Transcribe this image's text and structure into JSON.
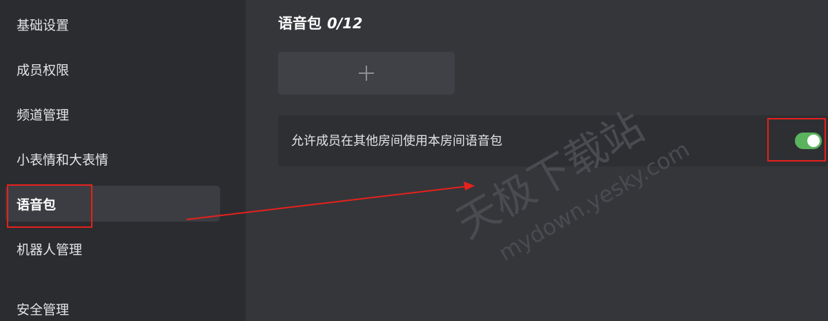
{
  "sidebar": {
    "items": [
      {
        "label": "基础设置"
      },
      {
        "label": "成员权限"
      },
      {
        "label": "频道管理"
      },
      {
        "label": "小表情和大表情"
      },
      {
        "label": "语音包"
      },
      {
        "label": "机器人管理"
      },
      {
        "label": "安全管理"
      }
    ],
    "active_index": 4
  },
  "main": {
    "title": "语音包",
    "count": "0/12",
    "add_button_icon": "plus-icon",
    "setting": {
      "label": "允许成员在其他房间使用本房间语音包",
      "enabled": true
    }
  },
  "watermark": {
    "text_cn": "天极下载站",
    "text_url": "mydown.yesky.com"
  },
  "colors": {
    "accent_toggle": "#5ab45e",
    "annotation_red": "#e8211b"
  }
}
